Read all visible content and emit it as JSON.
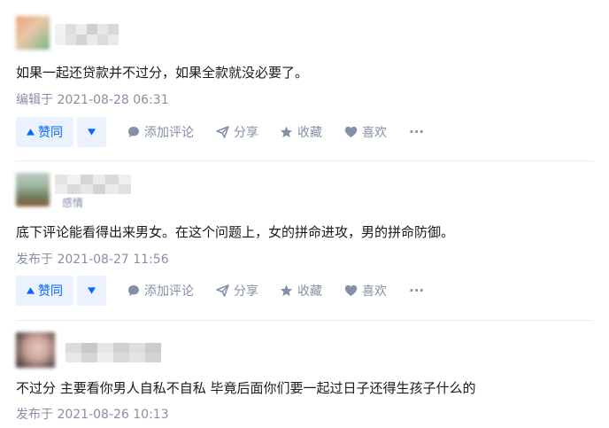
{
  "actions": {
    "upvote_label": "赞同",
    "comment_label": "添加评论",
    "share_label": "分享",
    "favorite_label": "收藏",
    "like_label": "喜欢",
    "more_label": "···"
  },
  "answers": [
    {
      "author_name": "",
      "author_headline": "",
      "content": "如果一起还贷款并不过分，如果全款就没必要了。",
      "timestamp": "编辑于 2021-08-28 06:31"
    },
    {
      "author_name": "",
      "author_headline": "感情",
      "content": "底下评论能看得出来男女。在这个问题上，女的拼命进攻，男的拼命防御。",
      "timestamp": "发布于 2021-08-27 11:56"
    },
    {
      "author_name": "",
      "author_headline": "",
      "content": "不过分 主要看你男人自私不自私 毕竟后面你们要一起过日子还得生孩子什么的",
      "timestamp": "发布于 2021-08-26 10:13"
    }
  ],
  "colors": {
    "accent": "#0066ff",
    "accent_bg": "#ebf2fd",
    "meta": "#8590a6",
    "divider": "#ebebeb"
  }
}
